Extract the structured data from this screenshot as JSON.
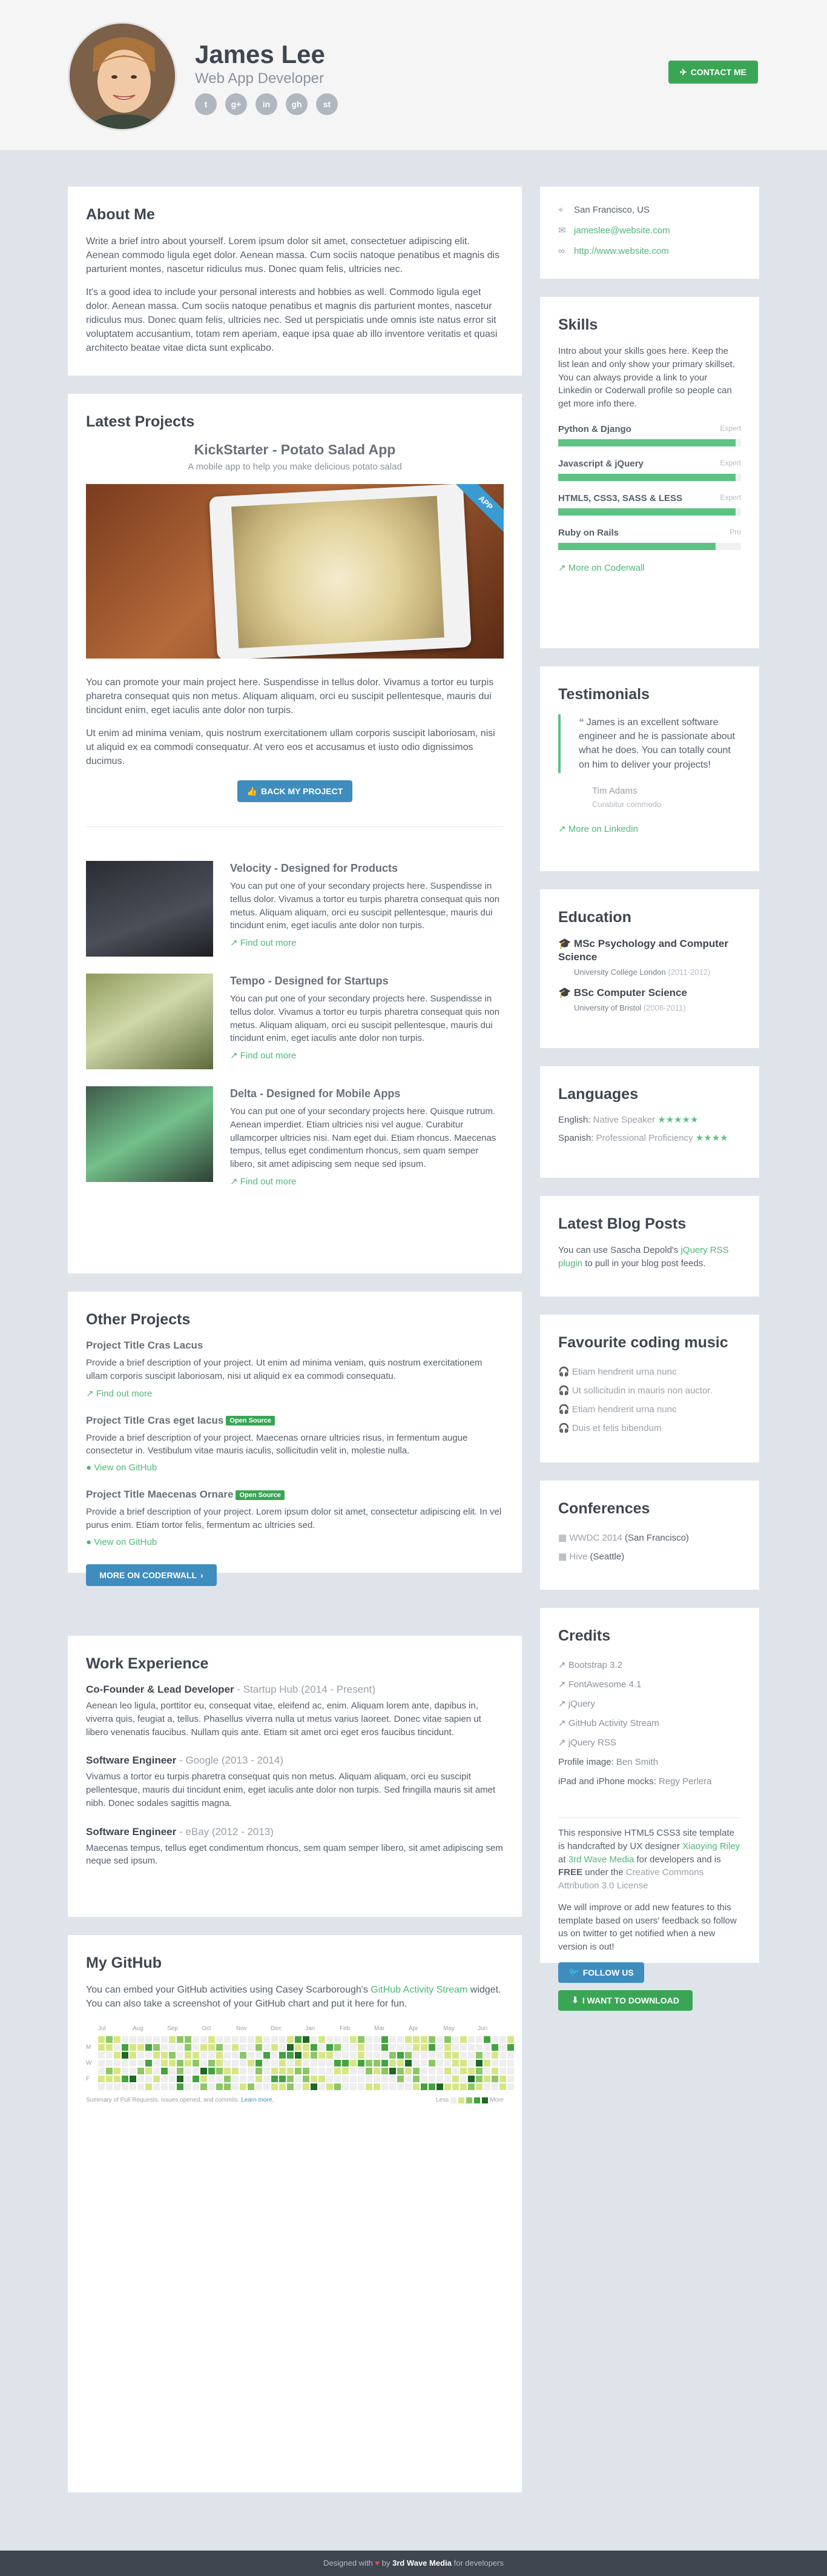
{
  "header": {
    "name": "James Lee",
    "role": "Web App Developer",
    "social": [
      "t",
      "g+",
      "in",
      "gh",
      "st"
    ],
    "contact_label": "CONTACT ME"
  },
  "about": {
    "title": "About Me",
    "p1": "Write a brief intro about yourself. Lorem ipsum dolor sit amet, consectetuer adipiscing elit. Aenean commodo ligula eget dolor. Aenean massa. Cum sociis natoque penatibus et magnis dis parturient montes, nascetur ridiculus mus. Donec quam felis, ultricies nec.",
    "p2": "It's a good idea to include your personal interests and hobbies as well. Commodo ligula eget dolor. Aenean massa. Cum sociis natoque penatibus et magnis dis parturient montes, nascetur ridiculus mus. Donec quam felis, ultricies nec. Sed ut perspiciatis unde omnis iste natus error sit voluptatem accusantium, totam rem aperiam, eaque ipsa quae ab illo inventore veritatis et quasi architecto beatae vitae dicta sunt explicabo."
  },
  "latest": {
    "title": "Latest Projects",
    "featured_title": "KickStarter - Potato Salad App",
    "featured_sub": "A mobile app to help you make delicious potato salad",
    "ribbon": "APP",
    "p1": "You can promote your main project here. Suspendisse in tellus dolor. Vivamus a tortor eu turpis pharetra consequat quis non metus. Aliquam aliquam, orci eu suscipit pellentesque, mauris dui tincidunt enim, eget iaculis ante dolor non turpis.",
    "p2": "Ut enim ad minima veniam, quis nostrum exercitationem ullam corporis suscipit laboriosam, nisi ut aliquid ex ea commodi consequatur. At vero eos et accusamus et iusto odio dignissimos ducimus.",
    "back_label": "BACK MY PROJECT",
    "items": [
      {
        "title": "Velocity - Designed for Products",
        "desc": "You can put one of your secondary projects here. Suspendisse in tellus dolor. Vivamus a tortor eu turpis pharetra consequat quis non metus. Aliquam aliquam, orci eu suscipit pellentesque, mauris dui tincidunt enim, eget iaculis ante dolor non turpis.",
        "link": "Find out more"
      },
      {
        "title": "Tempo - Designed for Startups",
        "desc": "You can put one of your secondary projects here. Suspendisse in tellus dolor. Vivamus a tortor eu turpis pharetra consequat quis non metus. Aliquam aliquam, orci eu suscipit pellentesque, mauris dui tincidunt enim, eget iaculis ante dolor non turpis.",
        "link": "Find out more"
      },
      {
        "title": "Delta - Designed for Mobile Apps",
        "desc": "You can put one of your secondary projects here. Quisque rutrum. Aenean imperdiet. Etiam ultricies nisi vel augue. Curabitur ullamcorper ultricies nisi. Nam eget dui. Etiam rhoncus. Maecenas tempus, tellus eget condimentum rhoncus, sem quam semper libero, sit amet adipiscing sem neque sed ipsum.",
        "link": "Find out more"
      }
    ]
  },
  "other": {
    "title": "Other Projects",
    "items": [
      {
        "title": "Project Title Cras Lacus",
        "tag": "",
        "desc": "Provide a brief description of your project. Ut enim ad minima veniam, quis nostrum exercitationem ullam corporis suscipit laboriosam, nisi ut aliquid ex ea commodi consequatu.",
        "link": "Find out more"
      },
      {
        "title": "Project Title Cras eget lacus",
        "tag": "Open Source",
        "desc": "Provide a brief description of your project. Maecenas ornare ultricies risus, in fermentum augue consectetur in. Vestibulum vitae mauris iaculis, sollicitudin velit in, molestie nulla.",
        "link": "View on GitHub"
      },
      {
        "title": "Project Title Maecenas Ornare",
        "tag": "Open Source",
        "desc": "Provide a brief description of your project. Lorem ipsum dolor sit amet, consectetur adipiscing elit. In vel purus enim. Etiam tortor felis, fermentum ac ultricies sed.",
        "link": "View on GitHub"
      }
    ],
    "more_label": "MORE ON CODERWALL"
  },
  "experience": {
    "title": "Work Experience",
    "jobs": [
      {
        "role": "Co-Founder & Lead Developer",
        "company": " - Startup Hub (2014 - Present)",
        "desc": "Aenean leo ligula, porttitor eu, consequat vitae, eleifend ac, enim. Aliquam lorem ante, dapibus in, viverra quis, feugiat a, tellus. Phasellus viverra nulla ut metus varius laoreet. Donec vitae sapien ut libero venenatis faucibus. Nullam quis ante. Etiam sit amet orci eget eros faucibus tincidunt."
      },
      {
        "role": "Software Engineer",
        "company": " - Google (2013 - 2014)",
        "desc": "Vivamus a tortor eu turpis pharetra consequat quis non metus. Aliquam aliquam, orci eu suscipit pellentesque, mauris dui tincidunt enim, eget iaculis ante dolor non turpis. Sed fringilla mauris sit amet nibh. Donec sodales sagittis magna."
      },
      {
        "role": "Software Engineer",
        "company": " - eBay (2012 - 2013)",
        "desc": "Maecenas tempus, tellus eget condimentum rhoncus, sem quam semper libero, sit amet adipiscing sem neque sed ipsum."
      }
    ]
  },
  "github": {
    "title": "My GitHub",
    "text_a": "You can embed your GitHub activities using Casey Scarborough's ",
    "link": "GitHub Activity Stream",
    "text_b": " widget. You can also take a screenshot of your GitHub chart and put it here for fun.",
    "months": [
      "Jul",
      "Aug",
      "Sep",
      "Oct",
      "Nov",
      "Dec",
      "Jan",
      "Feb",
      "Mar",
      "Apr",
      "May",
      "Jun"
    ],
    "days": [
      "M",
      "W",
      "F"
    ],
    "summary": "Summary of Pull Requests, issues opened, and commits. ",
    "learn": "Learn more.",
    "less": "Less",
    "more": "More"
  },
  "info": {
    "location": "San Francisco, US",
    "email": "jameslee@website.com",
    "site": "http://www.website.com"
  },
  "skills": {
    "title": "Skills",
    "intro": "Intro about your skills goes here. Keep the list lean and only show your primary skillset. You can always provide a link to your Linkedin or Coderwall profile so people can get more info there.",
    "items": [
      {
        "name": "Python & Django",
        "level": "Expert",
        "pct": 0.97
      },
      {
        "name": "Javascript & jQuery",
        "level": "Expert",
        "pct": 0.97
      },
      {
        "name": "HTML5, CSS3, SASS & LESS",
        "level": "Expert",
        "pct": 0.97
      },
      {
        "name": "Ruby on Rails",
        "level": "Pro",
        "pct": 0.86
      }
    ],
    "more": "More on Coderwall"
  },
  "testimonials": {
    "title": "Testimonials",
    "quote": "James is an excellent software engineer and he is passionate about what he does. You can totally count on him to deliver your projects!",
    "author": "Tim Adams",
    "author_title": "Curabitur commodo",
    "more": "More on Linkedin"
  },
  "education": {
    "title": "Education",
    "items": [
      {
        "degree": "MSc Psychology and Computer Science",
        "uni": "University College London",
        "years": "(2011-2012)"
      },
      {
        "degree": "BSc Computer Science",
        "uni": "University of Bristol",
        "years": "(2008-2011)"
      }
    ]
  },
  "languages": {
    "title": "Languages",
    "items": [
      {
        "lang": "English:",
        "level": "Native Speaker",
        "stars": "★★★★★"
      },
      {
        "lang": "Spanish:",
        "level": "Professional Proficiency",
        "stars": "★★★★"
      }
    ]
  },
  "blog": {
    "title": "Latest Blog Posts",
    "text_a": "You can use Sascha Depold's ",
    "link": "jQuery RSS plugin",
    "text_b": " to pull in your blog post feeds."
  },
  "music": {
    "title": "Favourite coding music",
    "items": [
      "Etiam hendrerit urna nunc",
      "Ut sollicitudin in mauris non auctor.",
      "Etiam hendrerit urna nunc",
      "Duis et felis bibendum"
    ]
  },
  "conferences": {
    "title": "Conferences",
    "items": [
      {
        "name": "WWDC 2014",
        "place": " (San Francisco)"
      },
      {
        "name": "Hive",
        "place": " (Seattle)"
      }
    ]
  },
  "credits": {
    "title": "Credits",
    "items": [
      "Bootstrap 3.2",
      "FontAwesome 4.1",
      "jQuery",
      "GitHub Activity Stream",
      "jQuery RSS"
    ],
    "profile_label": "Profile image: ",
    "profile_by": "Ben Smith",
    "mocks_label": "iPad and iPhone mocks: ",
    "mocks_by": "Regy Perlera",
    "blurb_a": "This responsive HTML5 CSS3 site template is handcrafted by UX designer ",
    "blurb_link1": "Xiaoying Riley",
    "blurb_b": " at ",
    "blurb_link2": "3rd Wave Media",
    "blurb_c": " for developers and is ",
    "blurb_free": "FREE",
    "blurb_d": " under the ",
    "blurb_link3": "Creative Commons Attribution 3.0 License",
    "improve": "We will improve or add new features to this template based on users' feedback so follow us on twitter to get notified when a new version is out!",
    "follow_label": "FOLLOW US",
    "download_label": "I WANT TO DOWNLOAD"
  },
  "footer": {
    "a": "Designed with ",
    "heart": "♥",
    "b": " by ",
    "brand": "3rd Wave Media",
    "c": " for developers"
  }
}
